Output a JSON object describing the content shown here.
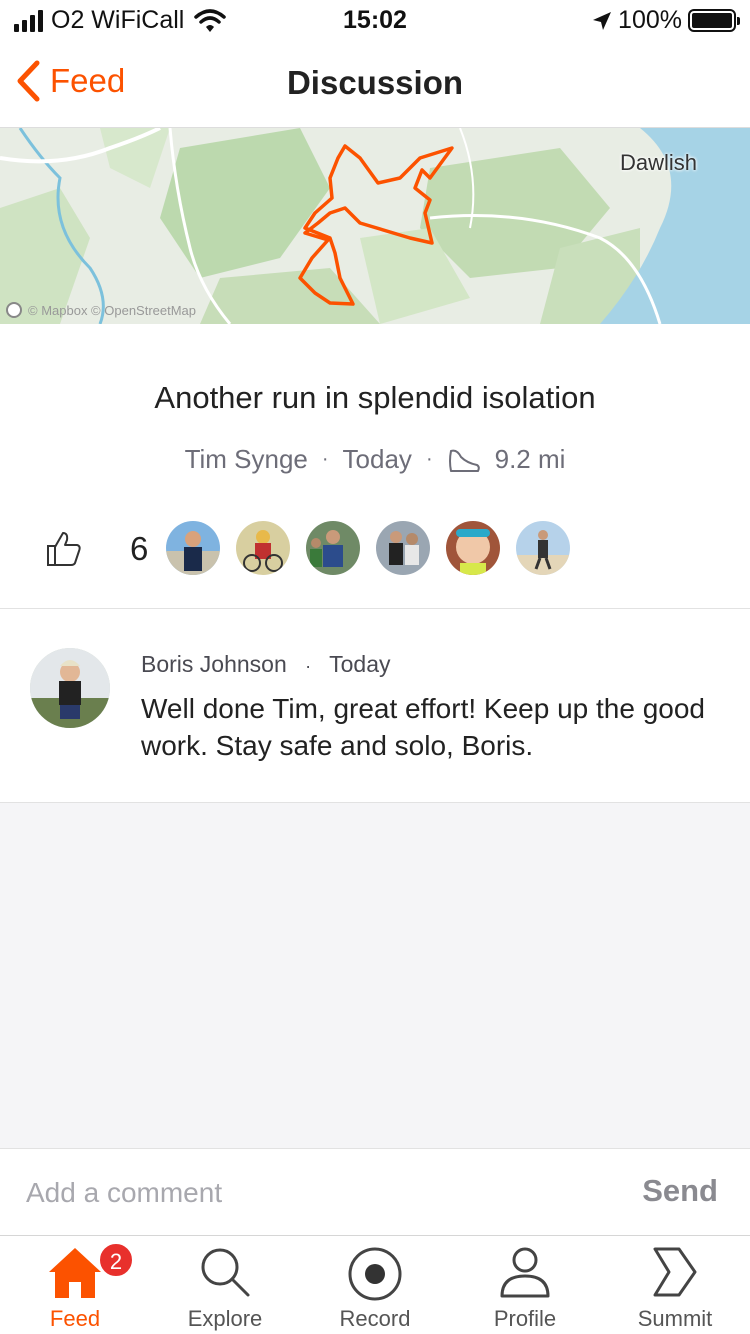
{
  "status_bar": {
    "carrier": "O2 WiFiCall",
    "time": "15:02",
    "battery": "100%"
  },
  "nav": {
    "back_label": "Feed",
    "title": "Discussion"
  },
  "map": {
    "place_label": "Dawlish",
    "attribution": "© Mapbox © OpenStreetMap",
    "route_color": "#fc5200"
  },
  "activity": {
    "title": "Another run in splendid isolation",
    "athlete": "Tim Synge",
    "date": "Today",
    "distance": "9.2 mi",
    "kudos_count": "6"
  },
  "comments": [
    {
      "author": "Boris Johnson",
      "time": "Today",
      "text": "Well done Tim, great effort! Keep up the good work. Stay safe and solo, Boris."
    }
  ],
  "comment_bar": {
    "placeholder": "Add a comment",
    "send_label": "Send"
  },
  "tabs": [
    {
      "label": "Feed",
      "icon": "home-icon",
      "badge": "2",
      "active": true
    },
    {
      "label": "Explore",
      "icon": "search-icon"
    },
    {
      "label": "Record",
      "icon": "record-icon"
    },
    {
      "label": "Profile",
      "icon": "profile-icon"
    },
    {
      "label": "Summit",
      "icon": "summit-icon"
    }
  ],
  "colors": {
    "brand": "#fc5200",
    "badge": "#e8302c"
  }
}
